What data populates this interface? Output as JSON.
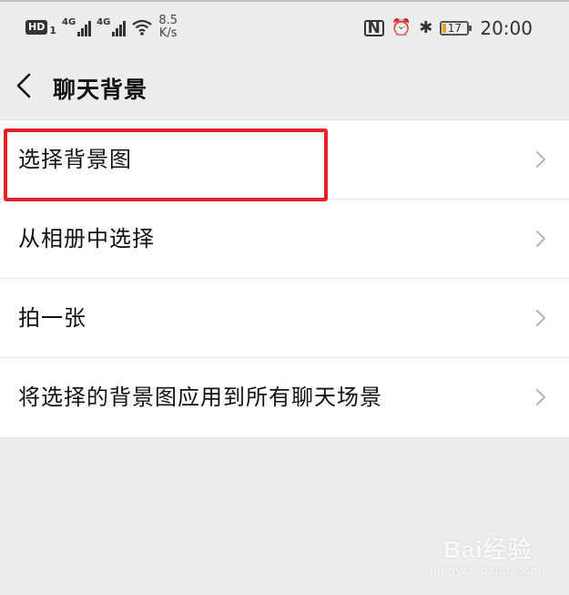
{
  "status_bar": {
    "hd_label": "HD",
    "hd_sub": "1",
    "signal1_gen": "4G",
    "signal2_gen": "4G",
    "net_speed_value": "8.5",
    "net_speed_unit": "K/s",
    "nfc_label": "N",
    "alarm_icon": "⏰",
    "bluetooth_icon": "✱",
    "battery_level": "17",
    "time": "20:00"
  },
  "header": {
    "title": "聊天背景"
  },
  "menu": {
    "items": [
      {
        "label": "选择背景图"
      },
      {
        "label": "从相册中选择"
      },
      {
        "label": "拍一张"
      },
      {
        "label": "将选择的背景图应用到所有聊天场景"
      }
    ]
  },
  "watermark": {
    "brand": "Bai经验",
    "domain": "jingyan.baidu.com"
  },
  "colors": {
    "background": "#ededed",
    "list_background": "#ffffff",
    "highlight": "#e8202a",
    "battery_fill": "#f0a030"
  }
}
